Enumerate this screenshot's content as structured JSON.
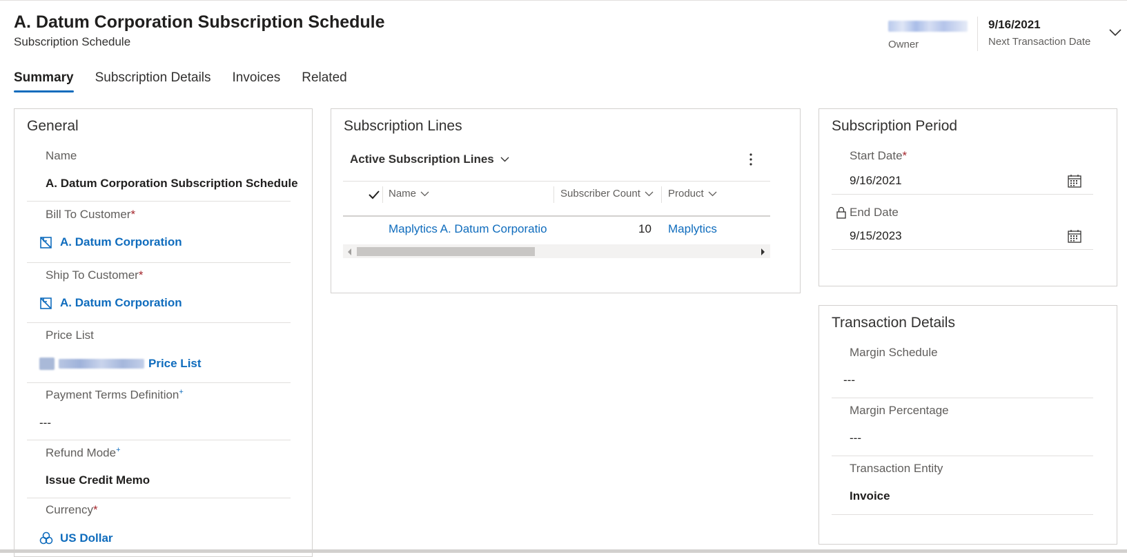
{
  "header": {
    "title": "A. Datum Corporation Subscription Schedule",
    "subtitle": "Subscription Schedule",
    "owner_label": "Owner",
    "next_transaction_date": "9/16/2021",
    "next_transaction_label": "Next Transaction Date"
  },
  "tabs": [
    {
      "label": "Summary",
      "active": true
    },
    {
      "label": "Subscription Details",
      "active": false
    },
    {
      "label": "Invoices",
      "active": false
    },
    {
      "label": "Related",
      "active": false
    }
  ],
  "general": {
    "title": "General",
    "name_label": "Name",
    "name_value": "A. Datum Corporation Subscription Schedule",
    "bill_to_label": "Bill To Customer",
    "bill_to_value": "A. Datum Corporation",
    "ship_to_label": "Ship To Customer",
    "ship_to_value": "A. Datum Corporation",
    "price_list_label": "Price List",
    "price_list_value": "Price List",
    "payment_terms_label": "Payment Terms Definition",
    "payment_terms_value": "---",
    "refund_mode_label": "Refund Mode",
    "refund_mode_value": "Issue Credit Memo",
    "currency_label": "Currency",
    "currency_value": "US Dollar",
    "required_mark": "*",
    "recommended_mark": "+"
  },
  "subscription_lines": {
    "title": "Subscription Lines",
    "view_name": "Active Subscription Lines",
    "columns": [
      "Name",
      "Subscriber Count",
      "Product"
    ],
    "rows": [
      {
        "name": "Maplytics A. Datum Corporatio",
        "subscriber_count": "10",
        "product": "Maplytics"
      }
    ]
  },
  "subscription_period": {
    "title": "Subscription Period",
    "start_date_label": "Start Date",
    "start_date_value": "9/16/2021",
    "end_date_label": "End Date",
    "end_date_value": "9/15/2023"
  },
  "transaction_details": {
    "title": "Transaction Details",
    "margin_schedule_label": "Margin Schedule",
    "margin_schedule_value": "---",
    "margin_percentage_label": "Margin Percentage",
    "margin_percentage_value": "---",
    "transaction_entity_label": "Transaction Entity",
    "transaction_entity_value": "Invoice"
  },
  "colors": {
    "accent": "#0f6cbd",
    "required": "#a4262c",
    "border": "#d2d0ce",
    "text": "#323130",
    "muted": "#605e5c"
  },
  "icons": {
    "account": "account-icon",
    "price_list": "price-list-icon",
    "currency": "currency-icon",
    "calendar": "calendar-icon",
    "lock": "lock-icon",
    "chevron": "chevron-down-icon",
    "more": "more-vertical-icon",
    "check": "checkmark-icon"
  }
}
